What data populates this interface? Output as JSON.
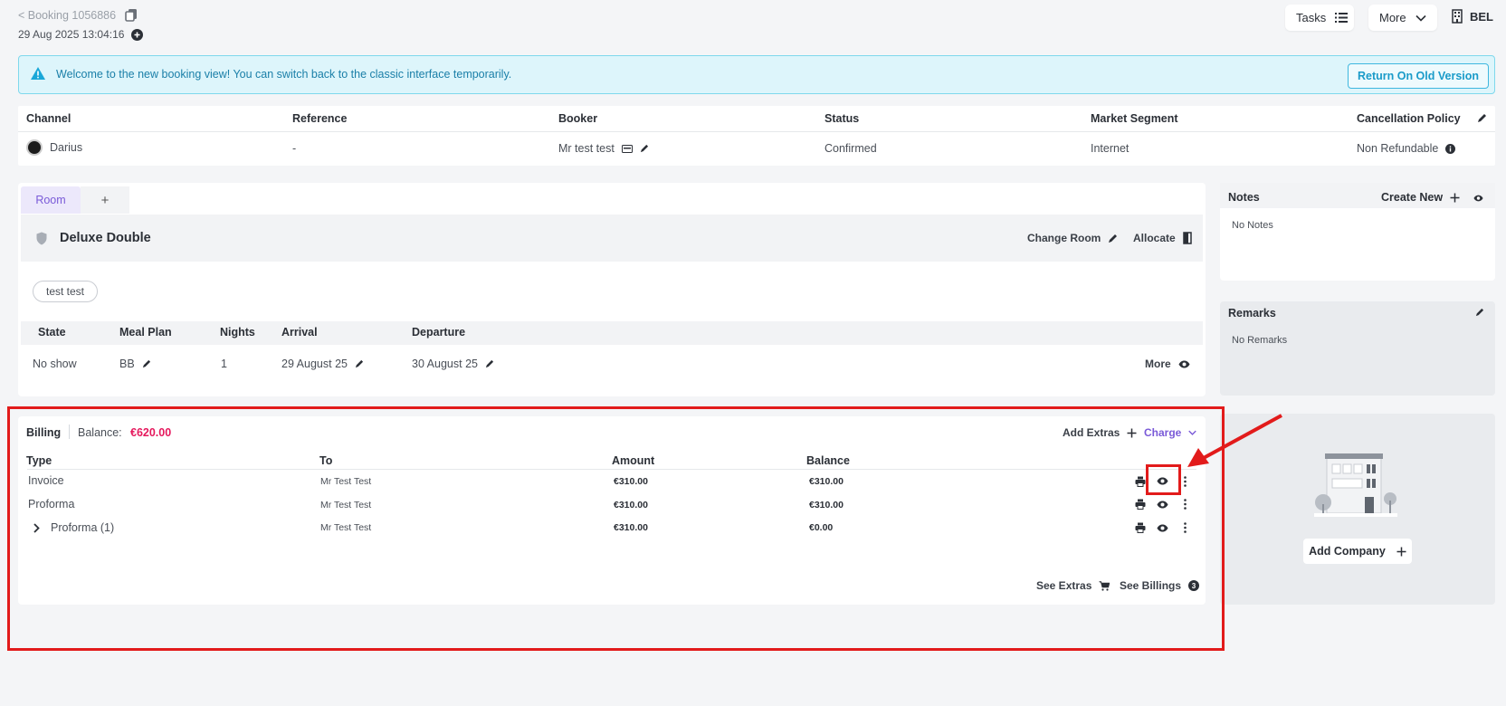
{
  "header": {
    "back_label": "< Booking 1056886",
    "timestamp": "29 Aug 2025 13:04:16",
    "tasks_label": "Tasks",
    "more_label": "More",
    "property_code": "BEL"
  },
  "banner": {
    "message": "Welcome to the new booking view! You can switch back to the classic interface temporarily.",
    "button_label": "Return On Old Version"
  },
  "summary": {
    "headers": [
      "Channel",
      "Reference",
      "Booker",
      "Status",
      "Market Segment",
      "Cancellation Policy"
    ],
    "channel": "Darius",
    "reference": "-",
    "booker": "Mr test test",
    "status": "Confirmed",
    "market_segment": "Internet",
    "cancellation_policy": "Non Refundable"
  },
  "room": {
    "tab_label": "Room",
    "tab_add": "+",
    "room_type": "Deluxe Double",
    "change_room_label": "Change Room",
    "allocate_label": "Allocate",
    "guest": "test test",
    "columns": [
      "State",
      "Meal Plan",
      "Nights",
      "Arrival",
      "Departure"
    ],
    "state": "No show",
    "meal_plan": "BB",
    "nights": "1",
    "arrival": "29 August 25",
    "departure": "30 August 25",
    "more_label": "More"
  },
  "notes": {
    "title": "Notes",
    "create_label": "Create New",
    "empty": "No Notes"
  },
  "remarks": {
    "title": "Remarks",
    "empty": "No Remarks"
  },
  "billing": {
    "title": "Billing",
    "balance_label": "Balance:",
    "balance_value": "€620.00",
    "add_extras_label": "Add Extras",
    "charge_label": "Charge",
    "columns": [
      "Type",
      "To",
      "Amount",
      "Balance"
    ],
    "rows": [
      {
        "type": "Invoice",
        "to": "Mr Test Test",
        "amount": "€310.00",
        "balance": "€310.00"
      },
      {
        "type": "Proforma",
        "to": "Mr Test Test",
        "amount": "€310.00",
        "balance": "€310.00"
      },
      {
        "type": "Proforma (1)",
        "to": "Mr Test Test",
        "amount": "€310.00",
        "balance": "€0.00"
      }
    ],
    "see_extras_label": "See Extras",
    "see_billings_label": "See Billings",
    "billings_count": "3"
  },
  "company": {
    "add_label": "Add Company"
  },
  "colors": {
    "accent_purple": "#7a5ad8",
    "balance_red": "#e5195d",
    "info_blue": "#1a9bc9",
    "annotation_red": "#e21b1b"
  }
}
